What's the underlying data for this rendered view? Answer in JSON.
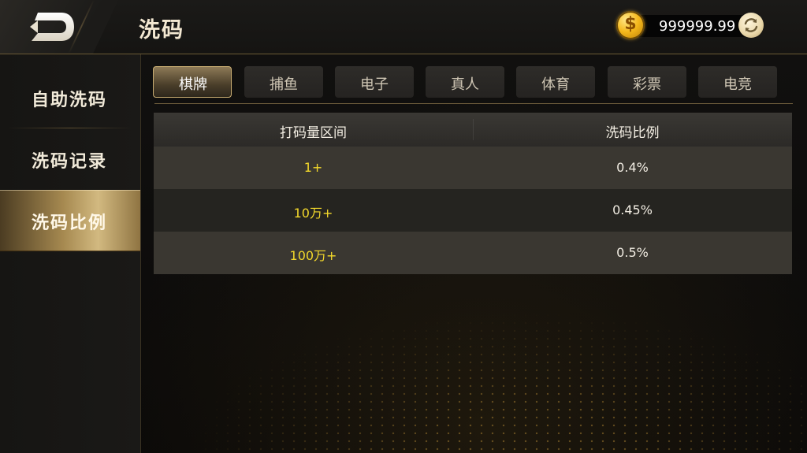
{
  "header": {
    "title": "洗码",
    "balance": "999999.99",
    "back_icon": "back-arrow-icon",
    "coin_icon": "dollar-coin-icon",
    "refresh_icon": "refresh-icon"
  },
  "sidebar": {
    "items": [
      {
        "label": "自助洗码",
        "active": false
      },
      {
        "label": "洗码记录",
        "active": false
      },
      {
        "label": "洗码比例",
        "active": true
      }
    ]
  },
  "tabs": [
    {
      "label": "棋牌",
      "active": true
    },
    {
      "label": "捕鱼",
      "active": false
    },
    {
      "label": "电子",
      "active": false
    },
    {
      "label": "真人",
      "active": false
    },
    {
      "label": "体育",
      "active": false
    },
    {
      "label": "彩票",
      "active": false
    },
    {
      "label": "电竞",
      "active": false
    }
  ],
  "table": {
    "headers": [
      "打码量区间",
      "洗码比例"
    ],
    "rows": [
      {
        "range": "1+",
        "ratio": "0.4%"
      },
      {
        "range": "10万+",
        "ratio": "0.45%"
      },
      {
        "range": "100万+",
        "ratio": "0.5%"
      }
    ]
  },
  "colors": {
    "accent_gold": "#c9ad72",
    "range_text": "#f3d82b",
    "background": "#0b0a09"
  }
}
